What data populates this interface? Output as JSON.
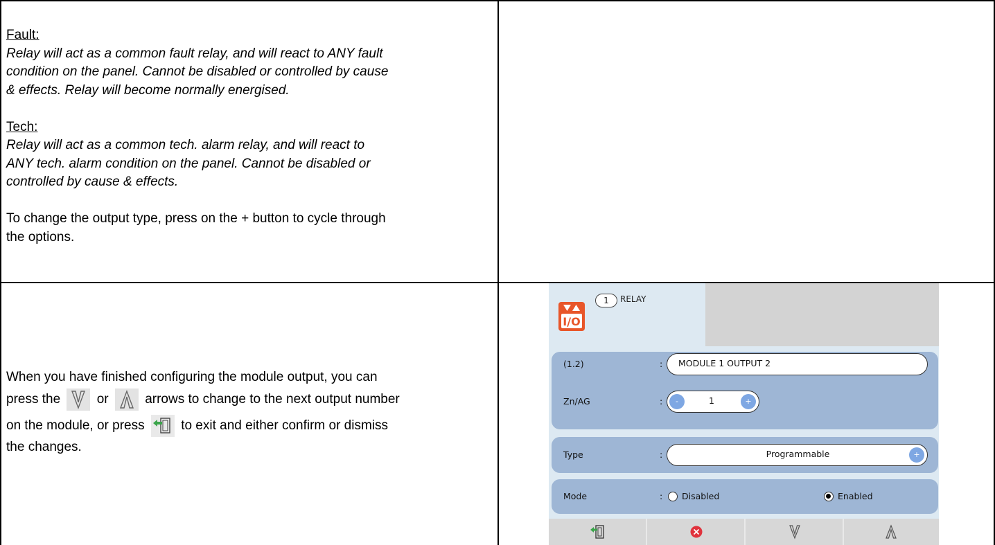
{
  "top_left": {
    "fault_heading": "Fault:",
    "fault_lines": [
      "Relay will act as a common fault relay, and will react to ANY fault",
      "condition on the panel. Cannot be disabled or controlled by cause",
      "& effects. Relay will become normally energised."
    ],
    "tech_heading": "Tech:",
    "tech_lines": [
      "Relay will act as a common tech. alarm relay, and will react to",
      "ANY tech. alarm condition on the panel. Cannot be disabled or",
      "controlled by cause & effects."
    ],
    "change_lines": [
      "To change the output type, press on the + button to cycle through",
      "the options."
    ]
  },
  "bottom_left": {
    "line1": "When you have finished configuring the module output, you can",
    "line2_a": "press the",
    "line2_b": "or",
    "line2_c": "arrows to change to the next output number",
    "line3_a": "on the module, or press",
    "line3_b": "to exit and either confirm or dismiss",
    "line4": "the changes."
  },
  "screen": {
    "badge_number": "1",
    "title": "RELAY",
    "address_label": "(1.2)",
    "name_value": "MODULE 1 OUTPUT 2",
    "zone_label": "Zn/AG",
    "zone_minus": "-",
    "zone_value": "1",
    "zone_plus": "+",
    "type_label": "Type",
    "type_value": "Programmable",
    "type_plus": "+",
    "mode_label": "Mode",
    "mode_options": [
      "Disabled",
      "Enabled"
    ],
    "mode_selected": "Enabled",
    "colon": ":",
    "buttons": [
      "exit-icon",
      "cancel-icon",
      "down-arrow-icon",
      "up-arrow-icon"
    ]
  },
  "colors": {
    "group_bg": "#9eb6d5",
    "screen_bg": "#dde9f2",
    "accent_orange": "#e8562a",
    "round_button": "#7ea7e3",
    "cancel_red": "#e0323c",
    "exit_green": "#3aa54a"
  }
}
